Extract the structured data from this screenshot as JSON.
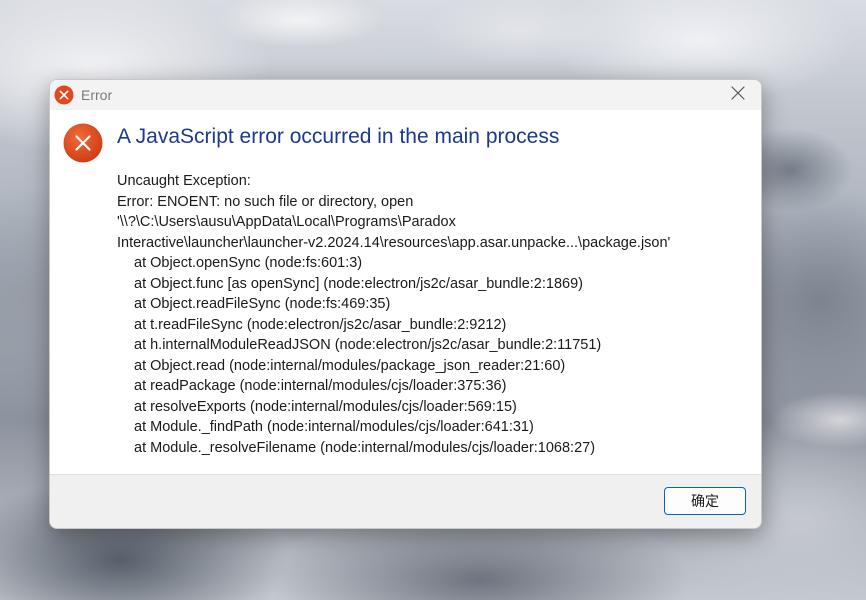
{
  "dialog": {
    "title": "Error",
    "title_icon": "error-icon",
    "close_icon": "close-icon",
    "main_instruction": "A JavaScript error occurred in the main process",
    "details": {
      "header": "Uncaught Exception:",
      "error_lines": [
        "Error: ENOENT: no such file or directory, open",
        "'\\\\?\\C:\\Users\\ausu\\AppData\\Local\\Programs\\Paradox",
        "Interactive\\launcher\\launcher-v2.2024.14\\resources\\app.asar.unpacke...\\package.json'"
      ],
      "stack": [
        "at Object.openSync (node:fs:601:3)",
        "at Object.func [as openSync] (node:electron/js2c/asar_bundle:2:1869)",
        "at Object.readFileSync (node:fs:469:35)",
        "at t.readFileSync (node:electron/js2c/asar_bundle:2:9212)",
        "at h.internalModuleReadJSON (node:electron/js2c/asar_bundle:2:11751)",
        "at Object.read (node:internal/modules/package_json_reader:21:60)",
        "at readPackage (node:internal/modules/cjs/loader:375:36)",
        "at resolveExports (node:internal/modules/cjs/loader:569:15)",
        "at Module._findPath (node:internal/modules/cjs/loader:641:31)",
        "at Module._resolveFilename (node:internal/modules/cjs/loader:1068:27)"
      ]
    },
    "ok_label": "确定"
  },
  "colors": {
    "error_red": "#e0491f",
    "instruction_blue": "#1c3a8c",
    "button_border": "#0067c0"
  }
}
